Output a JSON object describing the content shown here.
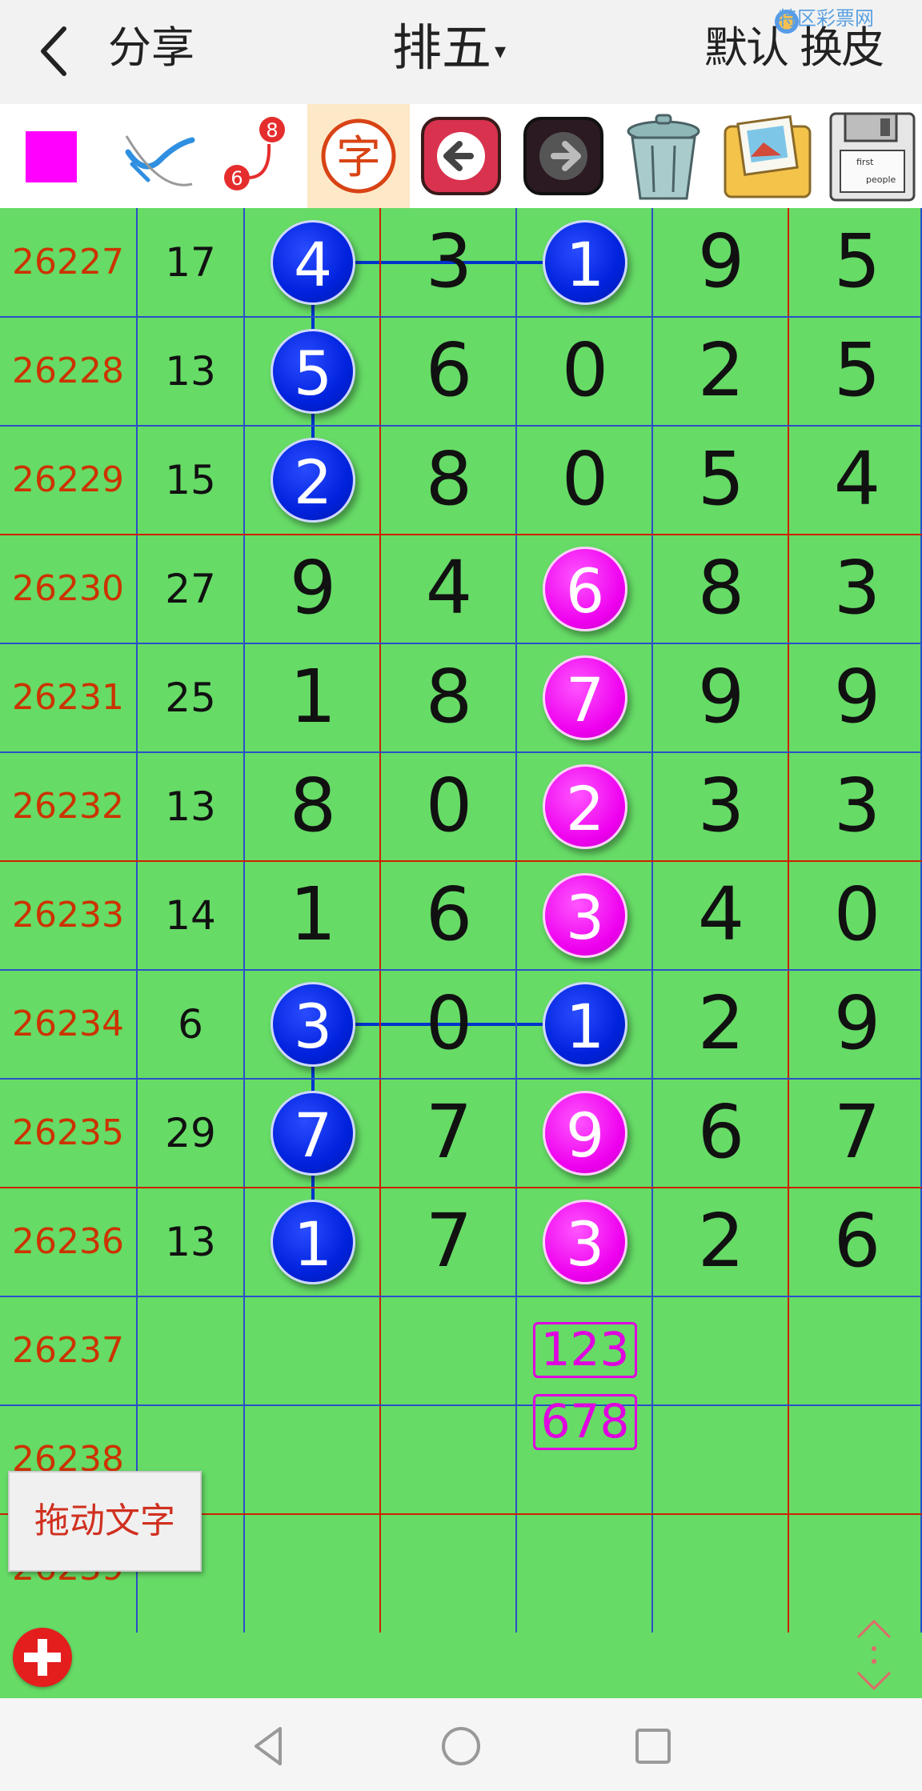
{
  "header": {
    "back_icon": "chevron-left-icon",
    "share_label": "分享",
    "title": "排五",
    "title_caret": "▾",
    "skin_label": "默认 换皮",
    "watermark": "特区彩票网"
  },
  "toolbar": {
    "tools": [
      "color-square",
      "pen-tool",
      "connect-tool",
      "text-tool",
      "undo-arrow",
      "redo-arrow",
      "trash-can",
      "photo-gallery",
      "save-disk"
    ],
    "color": "#ff00ff",
    "text_tool_char": "字",
    "connect_numbers": [
      "8",
      "6"
    ],
    "disk_label_1": "first",
    "disk_label_2": "people"
  },
  "rows": [
    {
      "issue": "26227",
      "sum": "17",
      "digits": [
        "4",
        "3",
        "1",
        "9",
        "5"
      ]
    },
    {
      "issue": "26228",
      "sum": "13",
      "digits": [
        "5",
        "6",
        "0",
        "2",
        "5"
      ]
    },
    {
      "issue": "26229",
      "sum": "15",
      "digits": [
        "2",
        "8",
        "0",
        "5",
        "4"
      ]
    },
    {
      "issue": "26230",
      "sum": "27",
      "digits": [
        "9",
        "4",
        "6",
        "8",
        "3"
      ]
    },
    {
      "issue": "26231",
      "sum": "25",
      "digits": [
        "1",
        "8",
        "7",
        "9",
        "9"
      ]
    },
    {
      "issue": "26232",
      "sum": "13",
      "digits": [
        "8",
        "0",
        "2",
        "3",
        "3"
      ]
    },
    {
      "issue": "26233",
      "sum": "14",
      "digits": [
        "1",
        "6",
        "3",
        "4",
        "0"
      ]
    },
    {
      "issue": "26234",
      "sum": "6",
      "digits": [
        "3",
        "0",
        "1",
        "2",
        "9"
      ]
    },
    {
      "issue": "26235",
      "sum": "29",
      "digits": [
        "7",
        "7",
        "9",
        "6",
        "7"
      ]
    },
    {
      "issue": "26236",
      "sum": "13",
      "digits": [
        "1",
        "7",
        "3",
        "2",
        "6"
      ]
    },
    {
      "issue": "26237",
      "sum": "",
      "digits": [
        "",
        "",
        "",
        "",
        ""
      ]
    },
    {
      "issue": "26238",
      "sum": "",
      "digits": [
        "",
        "",
        "",
        "",
        ""
      ]
    },
    {
      "issue": "26239",
      "sum": "",
      "digits": [
        "",
        "",
        "",
        "",
        ""
      ]
    }
  ],
  "highlights": [
    {
      "row": 0,
      "col": 0,
      "color": "blue"
    },
    {
      "row": 0,
      "col": 2,
      "color": "blue"
    },
    {
      "row": 1,
      "col": 0,
      "color": "blue"
    },
    {
      "row": 2,
      "col": 0,
      "color": "blue"
    },
    {
      "row": 3,
      "col": 2,
      "color": "pink"
    },
    {
      "row": 4,
      "col": 2,
      "color": "pink"
    },
    {
      "row": 5,
      "col": 2,
      "color": "pink"
    },
    {
      "row": 6,
      "col": 2,
      "color": "pink"
    },
    {
      "row": 7,
      "col": 0,
      "color": "blue"
    },
    {
      "row": 7,
      "col": 2,
      "color": "blue"
    },
    {
      "row": 8,
      "col": 0,
      "color": "blue"
    },
    {
      "row": 8,
      "col": 2,
      "color": "pink"
    },
    {
      "row": 9,
      "col": 0,
      "color": "blue"
    },
    {
      "row": 9,
      "col": 2,
      "color": "pink"
    }
  ],
  "predictions": [
    "123",
    "678"
  ],
  "drag_text_label": "拖动文字",
  "add_icon": "plus-circle-icon",
  "scroll_icon": "vertical-arrows-icon",
  "nav": [
    "back-triangle-icon",
    "home-circle-icon",
    "recent-square-icon"
  ],
  "colors": {
    "grid_bg": "#66db66",
    "issue_text": "#cc3300",
    "blue_ball": "#0022dd",
    "pink_ball": "#ee00ee",
    "line_blue": "#0033cc",
    "line_red": "#cc2200"
  }
}
